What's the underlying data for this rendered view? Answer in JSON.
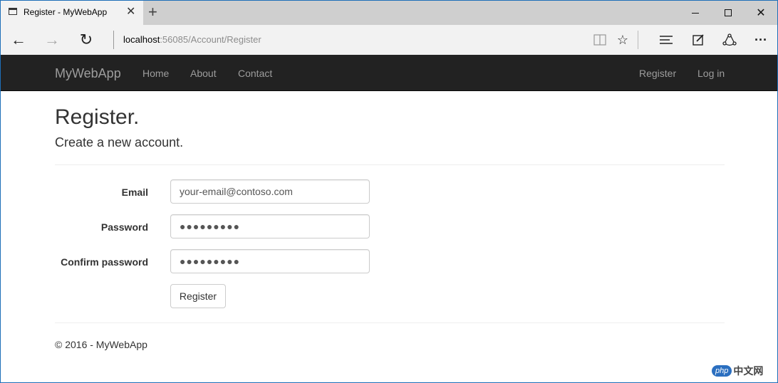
{
  "browser": {
    "tab_title": "Register - MyWebApp",
    "url_host": "localhost",
    "url_rest": ":56085/Account/Register",
    "icons": {
      "back": "back-arrow-icon",
      "forward": "forward-arrow-icon",
      "refresh": "refresh-icon",
      "reading": "reading-view-icon",
      "favorite": "star-icon",
      "hub": "hub-icon",
      "notes": "web-note-icon",
      "share": "share-icon",
      "more": "more-icon"
    }
  },
  "navbar": {
    "brand": "MyWebApp",
    "links": [
      "Home",
      "About",
      "Contact"
    ],
    "right_links": [
      "Register",
      "Log in"
    ]
  },
  "page": {
    "title": "Register.",
    "subtitle": "Create a new account."
  },
  "form": {
    "email_label": "Email",
    "email_value": "your-email@contoso.com",
    "password_label": "Password",
    "password_value": "●●●●●●●●●",
    "confirm_label": "Confirm password",
    "confirm_value": "●●●●●●●●●",
    "submit_label": "Register"
  },
  "footer": {
    "text": "© 2016 - MyWebApp"
  },
  "watermark": {
    "badge": "php",
    "text": "中文网"
  },
  "colors": {
    "navbar_bg": "#222222",
    "navbar_text": "#9d9d9d",
    "window_border": "#1e6fb8"
  }
}
